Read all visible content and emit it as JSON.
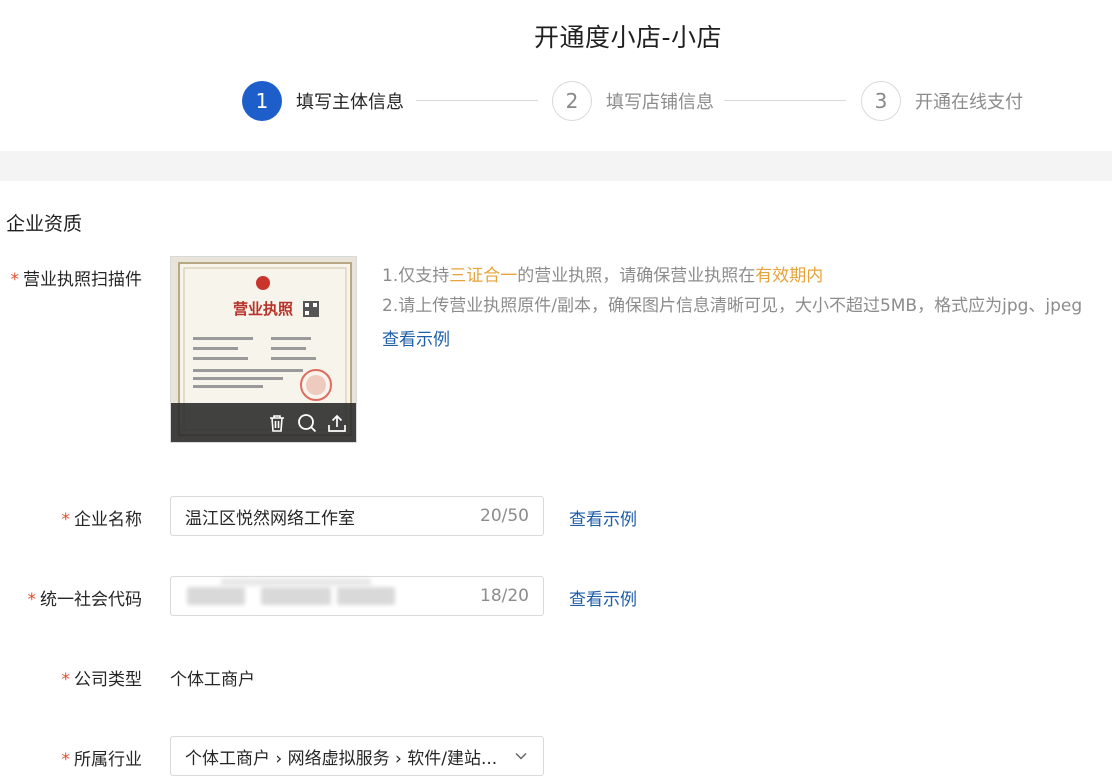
{
  "header": {
    "title": "开通度小店-小店"
  },
  "steps": [
    {
      "number": "1",
      "label": "填写主体信息",
      "state": "active"
    },
    {
      "number": "2",
      "label": "填写店铺信息",
      "state": "inactive"
    },
    {
      "number": "3",
      "label": "开通在线支付",
      "state": "inactive"
    }
  ],
  "section": {
    "title": "企业资质"
  },
  "license": {
    "label": "营业执照扫描件",
    "image_caption": "营业执照",
    "hint1_prefix": "1.仅支持",
    "hint1_highlight1": "三证合一",
    "hint1_middle": "的营业执照，请确保营业执照在",
    "hint1_highlight2": "有效期内",
    "hint2": "2.请上传营业执照原件/副本，确保图片信息清晰可见，大小不超过5MB，格式应为jpg、jpeg",
    "example_link": "查看示例"
  },
  "company_name": {
    "label": "企业名称",
    "value": "温江区悦然网络工作室",
    "count": "20/50",
    "example_link": "查看示例"
  },
  "credit_code": {
    "label": "统一社会代码",
    "count": "18/20",
    "example_link": "查看示例"
  },
  "company_type": {
    "label": "公司类型",
    "value": "个体工商户"
  },
  "industry": {
    "label": "所属行业",
    "value": "个体工商户 › 网络虚拟服务 › 软件/建站..."
  },
  "colors": {
    "accent": "#1e5ecb",
    "link": "#1e5ea9",
    "highlight": "#e8a33a",
    "required": "#e34d2f"
  }
}
